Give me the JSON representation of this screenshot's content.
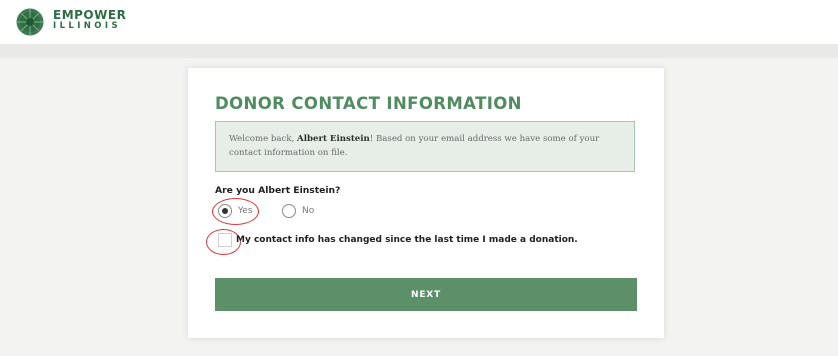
{
  "brand": {
    "name_line1": "EMPOWER",
    "name_line2": "ILLINOIS",
    "logo_icon": "empower-leaf-burst-icon",
    "color": "#2f6e44"
  },
  "form": {
    "title": "DONOR CONTACT INFORMATION",
    "notice": {
      "prefix": "Welcome back, ",
      "name": "Albert Einstein",
      "suffix": "! Based on your email address we have some of your contact information on file."
    },
    "question": "Are you Albert Einstein?",
    "options": [
      {
        "label": "Yes",
        "checked": true
      },
      {
        "label": "No",
        "checked": false
      }
    ],
    "checkbox_label": "My contact info has changed since the last time I made a donation.",
    "checkbox_checked": false,
    "next_label": "NEXT"
  },
  "colors": {
    "accent": "#5b9068",
    "title": "#4f8c60",
    "notice_bg": "#e6eee7",
    "annotation": "#d93a3a"
  }
}
